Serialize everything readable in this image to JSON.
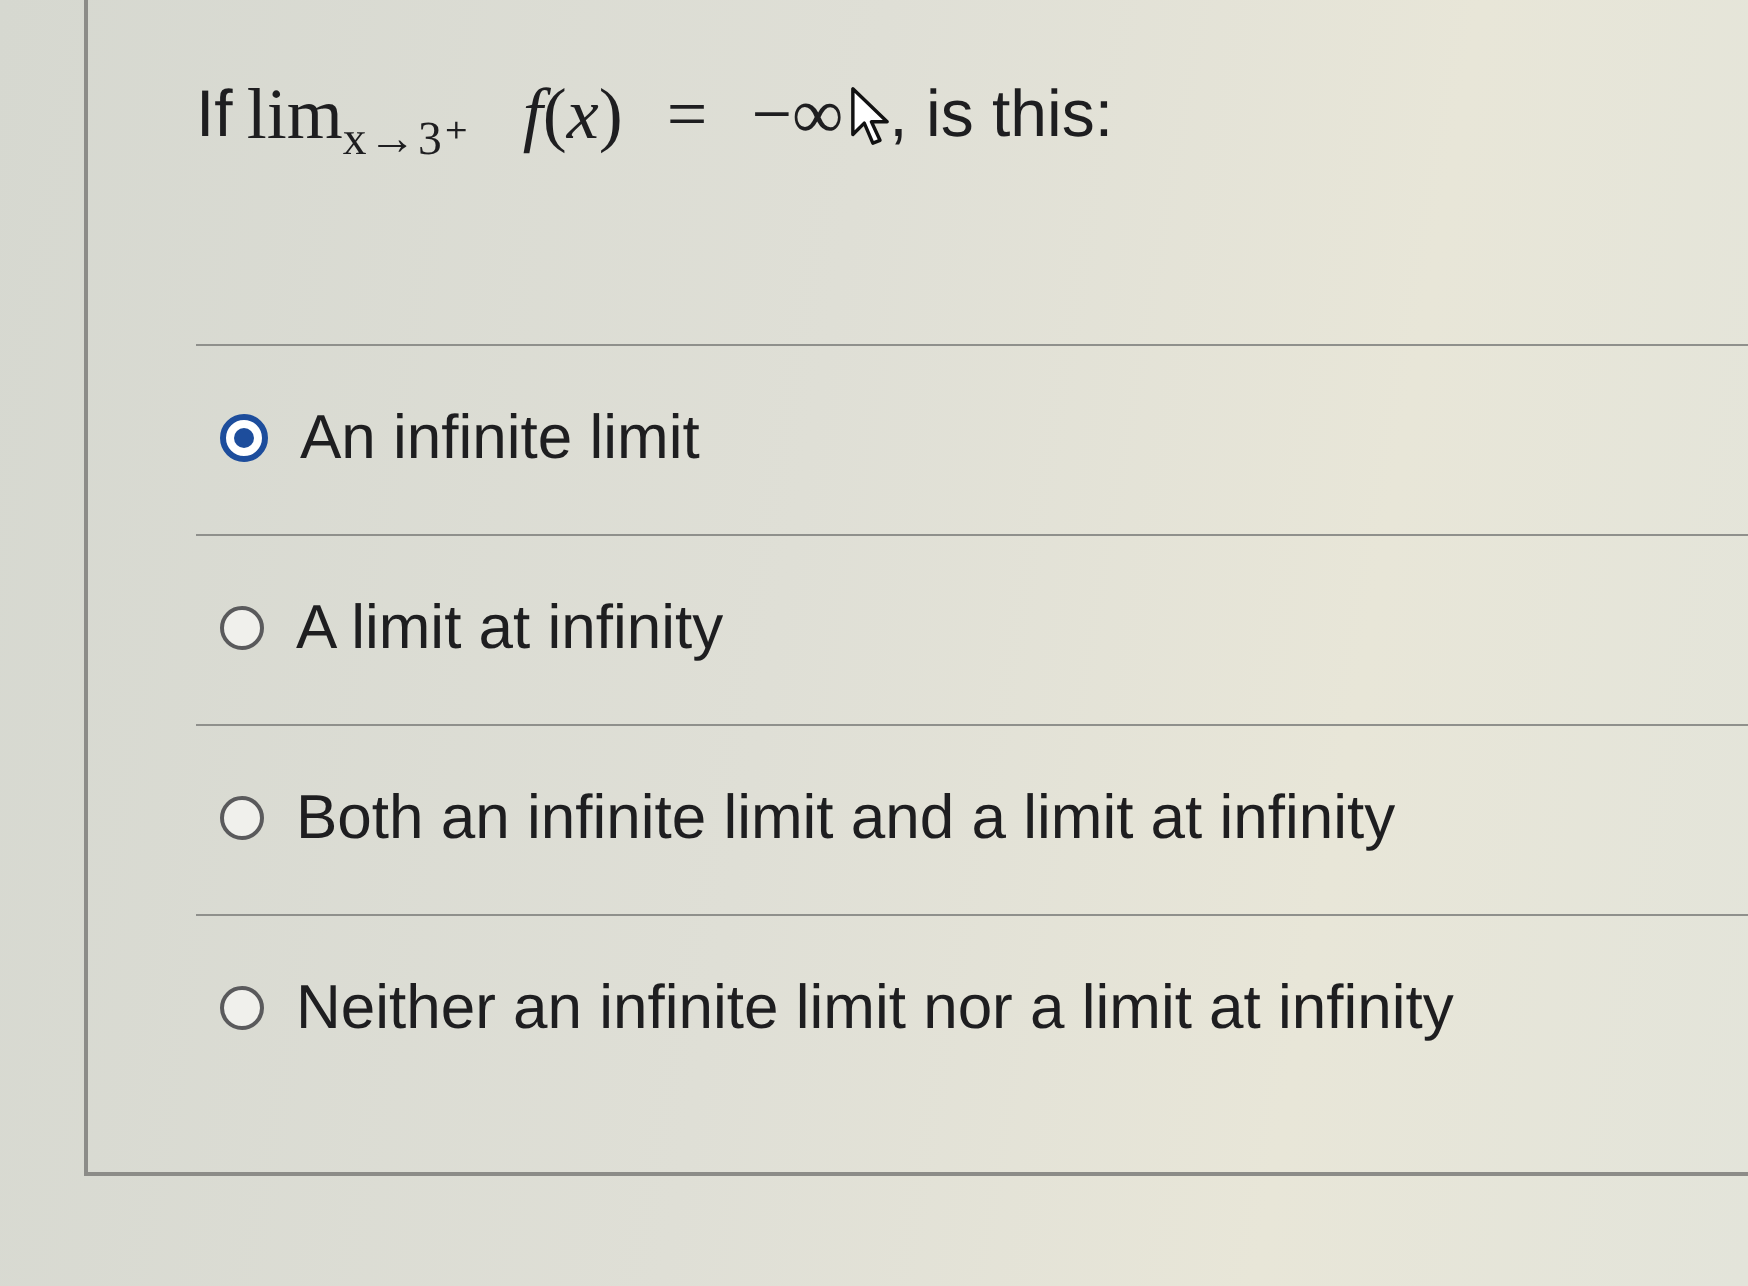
{
  "question": {
    "lead": "If",
    "formula": "lim$_{x→3⁺}$ *f*(*x*) = −∞",
    "tail": ", is this:"
  },
  "options": [
    {
      "label": "An infinite limit",
      "selected": true
    },
    {
      "label": "A limit at infinity",
      "selected": false
    },
    {
      "label": "Both an infinite limit and a limit at infinity",
      "selected": false
    },
    {
      "label": "Neither an infinite limit nor a limit at infinity",
      "selected": false
    }
  ]
}
